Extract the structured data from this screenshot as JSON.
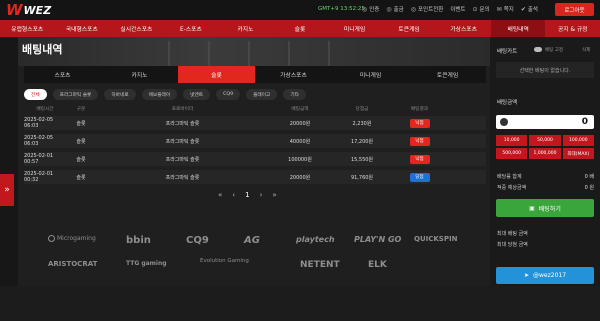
{
  "header": {
    "logo_mark": "W",
    "logo_text": "WEZ",
    "clock": "GMT+9 13:52:25",
    "links": [
      "인증",
      "출금",
      "포인트전환",
      "이벤트",
      "문의",
      "쪽지",
      "출석"
    ],
    "login_label": "로그아웃"
  },
  "nav": {
    "items": [
      "유럽형스포츠",
      "국내형스포츠",
      "실시간스포츠",
      "E-스포츠",
      "카지노",
      "슬롯",
      "미니게임",
      "토큰게임",
      "가상스포츠",
      "배팅내역",
      "공지 & 규정"
    ]
  },
  "main": {
    "title": "배팅내역",
    "tabs": [
      "스포츠",
      "카지노",
      "슬롯",
      "가상스포츠",
      "미니게임",
      "토큰게임"
    ],
    "chips": [
      "전체",
      "프라그마틱 슬롯",
      "하바네로",
      "에보플레이",
      "넷엔트",
      "CQ9",
      "플레이고",
      "기타"
    ],
    "columns": [
      "배팅시간",
      "구분",
      "프로바이더",
      "배팅금액",
      "당첨금",
      "배팅결과"
    ],
    "rows": [
      {
        "time": "2025-02-05 06:03",
        "type": "슬롯",
        "provider": "프라그마틱 슬롯",
        "amount": "20000원",
        "win": "2,230원",
        "result": "낙첨",
        "status": "loss"
      },
      {
        "time": "2025-02-05 06:03",
        "type": "슬롯",
        "provider": "프라그마틱 슬롯",
        "amount": "40000원",
        "win": "17,200원",
        "result": "낙첨",
        "status": "loss"
      },
      {
        "time": "2025-02-01 00:57",
        "type": "슬롯",
        "provider": "프라그마틱 슬롯",
        "amount": "100000원",
        "win": "15,550원",
        "result": "낙첨",
        "status": "loss"
      },
      {
        "time": "2025-02-01 00:32",
        "type": "슬롯",
        "provider": "프라그마틱 슬롯",
        "amount": "20000원",
        "win": "91,760원",
        "result": "당첨",
        "status": "win"
      }
    ],
    "pager": {
      "first": "«",
      "prev": "‹",
      "current": "1",
      "next": "›",
      "last": "»"
    }
  },
  "logos": [
    "Microgaming",
    "bbin",
    "CQ9",
    "AG",
    "playtech",
    "PLAY'N GO",
    "QUICKSPIN",
    "ARISTOCRAT",
    "TTG gaming",
    "Evolution Gaming",
    "NETENT",
    "ELK"
  ],
  "cart": {
    "title": "배팅카트",
    "fixed_label": "배팅 고정",
    "delete_label": "삭제",
    "empty": "선택한 배팅이 없습니다."
  },
  "bet": {
    "title": "배팅금액",
    "amount": "0",
    "quick": [
      "10,000",
      "50,000",
      "100,000",
      "500,000",
      "1,000,000",
      "최대(MAX)"
    ],
    "odds_label": "배당률 합계",
    "odds_value": "0 배",
    "expected_label": "적중 예상금액",
    "expected_value": "0 원",
    "button": "배팅하기",
    "max_bet_label": "최대 배팅 금액",
    "max_win_label": "최대 당첨 금액"
  },
  "telegram": "@wez2017",
  "colors": {
    "accent": "#e2281e",
    "nav": "#b5161b",
    "win": "#1f6fd6",
    "bet_button": "#3aa53a",
    "telegram": "#2392d8"
  }
}
